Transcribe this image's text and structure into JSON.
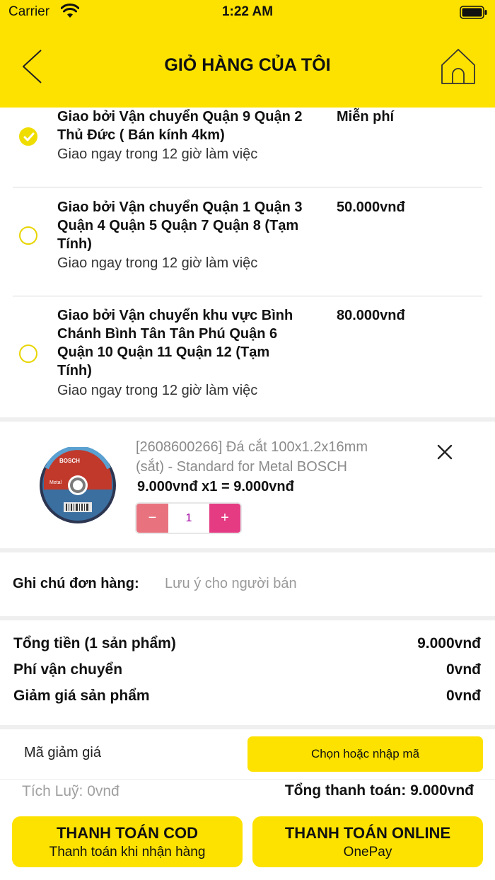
{
  "status_bar": {
    "carrier": "Carrier",
    "time": "1:22 AM"
  },
  "header": {
    "title": "GIỎ HÀNG CỦA TÔI",
    "back_icon": "chevron-left-icon",
    "home_icon": "home-icon"
  },
  "shipping": [
    {
      "name_lines": [
        "Giao bởi Vận chuyển Quận 9 Quận 2",
        "Thủ Đức ( Bán kính 4km)"
      ],
      "price": "Miễn phí",
      "sub": "Giao ngay trong 12 giờ làm việc",
      "selected": true
    },
    {
      "name_lines": [
        "Giao bởi Vận chuyển Quận 1 Quận 3",
        "Quận 4 Quận 5 Quận 7 Quận 8 (Tạm",
        "Tính)"
      ],
      "price": "50.000vnđ",
      "sub": "Giao ngay trong 12 giờ làm việc",
      "selected": false
    },
    {
      "name_lines": [
        "Giao bởi Vận chuyển khu vực Bình",
        "Chánh Bình Tân Tân Phú Quận 6",
        "Quận 10 Quận 11 Quận 12 (Tạm",
        "Tính)"
      ],
      "price": "80.000vnđ",
      "sub": "Giao ngay trong 12 giờ làm việc",
      "selected": false
    }
  ],
  "product": {
    "name_line1": "[2608600266] Đá cắt 100x1.2x16mm",
    "name_line2": "(sắt) - Standard for Metal BOSCH",
    "price_line": "9.000vnđ x1 = 9.000vnđ",
    "quantity": "1",
    "minus_label": "−",
    "plus_label": "+",
    "disc_brand": "BOSCH",
    "disc_label": "Metal"
  },
  "note": {
    "label": "Ghi chú đơn hàng:",
    "placeholder": "Lưu ý cho người bán"
  },
  "totals": [
    {
      "label": "Tổng tiền (1 sản phẩm)",
      "value": "9.000vnđ"
    },
    {
      "label": "Phí vận chuyển",
      "value": "0vnđ"
    },
    {
      "label": "Giảm giá sản phẩm",
      "value": "0vnđ"
    }
  ],
  "coupon": {
    "label": "Mã giảm giá",
    "button": "Chọn hoặc nhập mã"
  },
  "points": "Tích Luỹ: 0vnđ",
  "grand_total": "Tổng thanh toán: 9.000vnđ",
  "buttons": {
    "cod_main": "THANH TOÁN COD",
    "cod_sub": "Thanh toán khi nhận hàng",
    "online_main": "THANH TOÁN ONLINE",
    "online_sub": "OnePay"
  },
  "colors": {
    "brand_yellow": "#fde200",
    "minus_red": "#e8737f",
    "plus_pink": "#e43b83"
  }
}
